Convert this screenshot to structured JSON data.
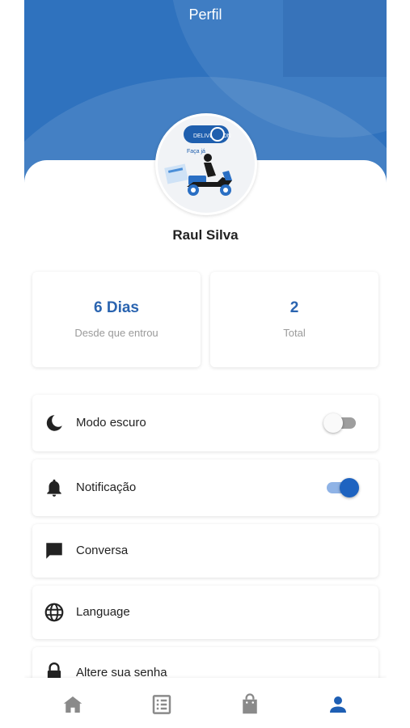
{
  "header": {
    "title": "Perfil"
  },
  "profile": {
    "name": "Raul Silva",
    "avatar_logo_text": "DELIVERY ON",
    "avatar_tagline": "Faça já"
  },
  "stats": [
    {
      "value": "6 Dias",
      "label": "Desde que entrou"
    },
    {
      "value": "2",
      "label": "Total"
    }
  ],
  "settings": [
    {
      "icon": "moon-icon",
      "label": "Modo escuro",
      "toggle": false
    },
    {
      "icon": "bell-icon",
      "label": "Notificação",
      "toggle": true
    },
    {
      "icon": "chat-icon",
      "label": "Conversa"
    },
    {
      "icon": "globe-icon",
      "label": "Language"
    },
    {
      "icon": "lock-icon",
      "label": "Altere sua senha"
    }
  ],
  "nav": {
    "items": [
      "home-icon",
      "list-icon",
      "shopping-bag-icon",
      "person-icon"
    ],
    "active": "person-icon"
  },
  "colors": {
    "header": "#2f72be",
    "accent": "#2a64b0",
    "toggle_on": "#1e63c0",
    "nav_active": "#1e5fb4",
    "nav_inactive": "#8a8a8a"
  }
}
